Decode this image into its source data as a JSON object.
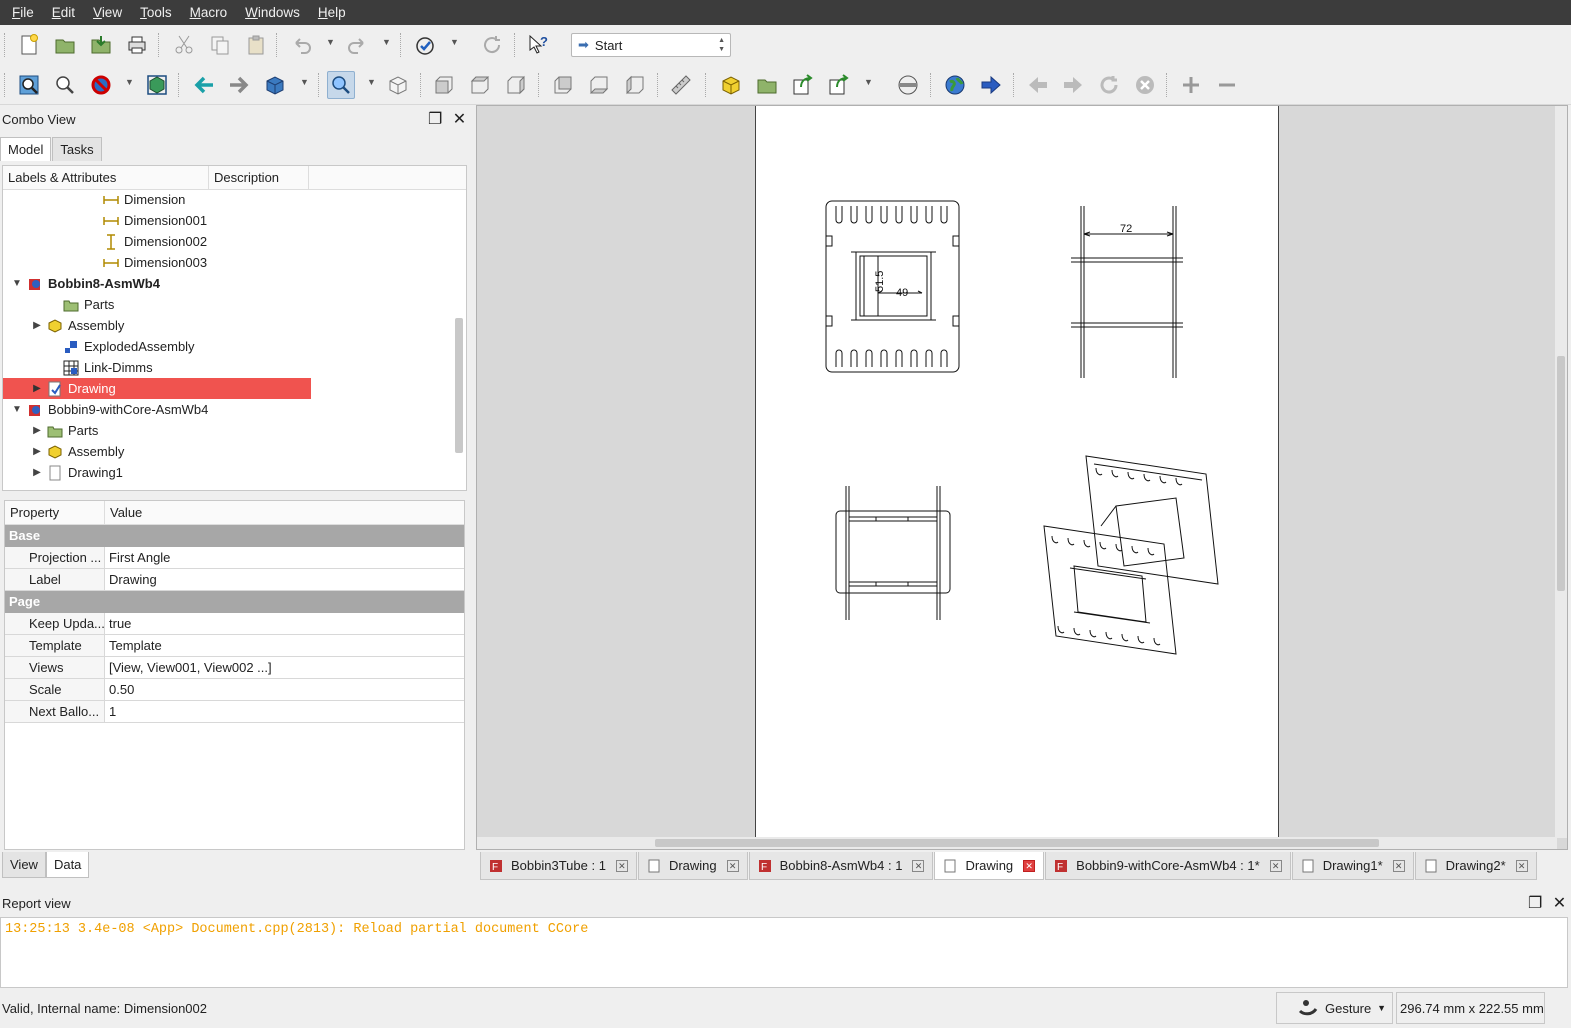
{
  "menu": [
    {
      "key": "F",
      "rest": "ile"
    },
    {
      "key": "E",
      "rest": "dit"
    },
    {
      "key": "V",
      "rest": "iew"
    },
    {
      "key": "T",
      "rest": "ools"
    },
    {
      "key": "M",
      "rest": "acro"
    },
    {
      "key": "W",
      "rest": "indows"
    },
    {
      "key": "H",
      "rest": "elp"
    }
  ],
  "toolbar": {
    "workbench": "Start"
  },
  "combo": {
    "title": "Combo View",
    "tabs": [
      "Model",
      "Tasks"
    ],
    "tree_headers": [
      "Labels & Attributes",
      "Description"
    ],
    "tree_items": [
      {
        "label": "Dimension",
        "icon": "dimension-icon",
        "expand": ""
      },
      {
        "label": "Dimension001",
        "icon": "dimension-icon",
        "expand": ""
      },
      {
        "label": "Dimension002",
        "icon": "dimension-vertical-icon",
        "expand": ""
      },
      {
        "label": "Dimension003",
        "icon": "dimension-icon",
        "expand": ""
      },
      {
        "label": "Bobbin8-AsmWb4",
        "icon": "document-icon",
        "expand": "▼",
        "bold": true
      },
      {
        "label": "Parts",
        "icon": "folder-icon",
        "expand": ""
      },
      {
        "label": "Assembly",
        "icon": "assembly-icon",
        "expand": "▶"
      },
      {
        "label": "ExplodedAssembly",
        "icon": "exploded-icon",
        "expand": ""
      },
      {
        "label": "Link-Dimms",
        "icon": "link-icon",
        "expand": ""
      },
      {
        "label": "Drawing",
        "icon": "drawing-icon",
        "expand": "▶",
        "selected": true
      },
      {
        "label": "Bobbin9-withCore-AsmWb4",
        "icon": "document-icon",
        "expand": "▼"
      },
      {
        "label": "Parts",
        "icon": "folder-icon",
        "expand": "▶"
      },
      {
        "label": "Assembly",
        "icon": "assembly-icon",
        "expand": "▶"
      },
      {
        "label": "Drawing1",
        "icon": "page-icon",
        "expand": "▶"
      }
    ],
    "prop_headers": [
      "Property",
      "Value"
    ],
    "groups": [
      {
        "name": "Base",
        "rows": [
          {
            "key": "Projection ...",
            "value": "First Angle"
          },
          {
            "key": "Label",
            "value": "Drawing"
          }
        ]
      },
      {
        "name": "Page",
        "rows": [
          {
            "key": "Keep Upda...",
            "value": "true"
          },
          {
            "key": "Template",
            "value": "Template"
          },
          {
            "key": "Views",
            "value": "[View, View001, View002 ...]"
          },
          {
            "key": "Scale",
            "value": "0.50"
          },
          {
            "key": "Next Ballo...",
            "value": "1"
          }
        ]
      }
    ],
    "bottom_tabs": [
      "View",
      "Data"
    ]
  },
  "drawing": {
    "dim_72": "72",
    "dim_515": "51.5",
    "dim_49": "49"
  },
  "doc_tabs": [
    {
      "label": "Bobbin3Tube : 1",
      "icon": "freecad-icon"
    },
    {
      "label": "Drawing",
      "icon": "page-icon"
    },
    {
      "label": "Bobbin8-AsmWb4 : 1",
      "icon": "freecad-icon"
    },
    {
      "label": "Drawing",
      "icon": "page-icon",
      "selected": true
    },
    {
      "label": "Bobbin9-withCore-AsmWb4 : 1*",
      "icon": "freecad-icon"
    },
    {
      "label": "Drawing1*",
      "icon": "page-icon"
    },
    {
      "label": "Drawing2*",
      "icon": "page-icon"
    }
  ],
  "report": {
    "title": "Report view",
    "message": "13:25:13  3.4e-08 <App> Document.cpp(2813): Reload partial document CCore"
  },
  "status": {
    "text": "Valid, Internal name: Dimension002",
    "nav_style": "Gesture",
    "dimensions": "296.74 mm x 222.55 mm"
  },
  "colors": {
    "selection": "#f0534f",
    "menubar": "#3c3c3c",
    "report_text": "#f0a000"
  }
}
